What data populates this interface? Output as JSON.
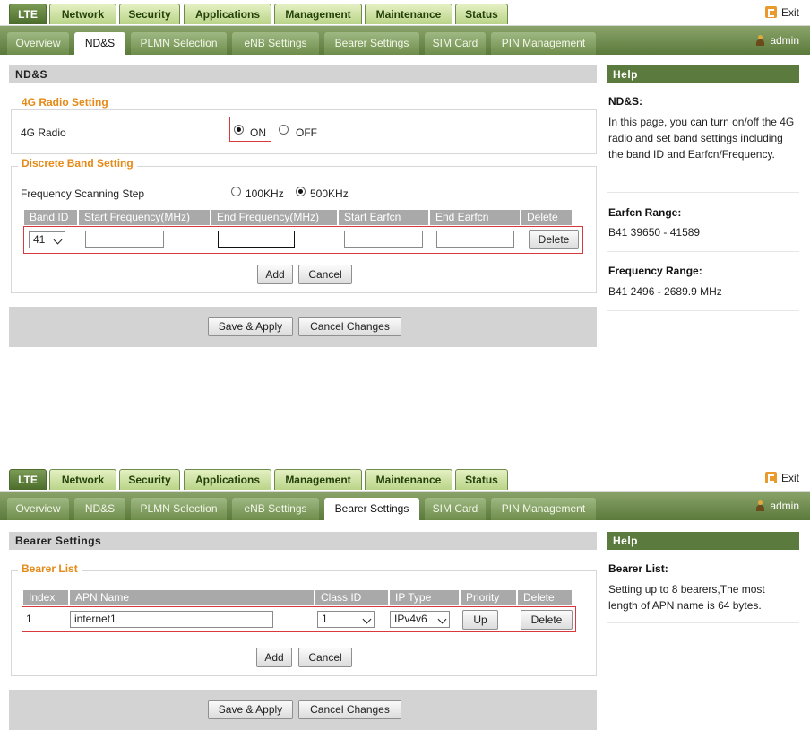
{
  "panel1": {
    "top_tabs": [
      "LTE",
      "Network",
      "Security",
      "Applications",
      "Management",
      "Maintenance",
      "Status"
    ],
    "exit_label": "Exit",
    "sub_tabs": [
      "Overview",
      "ND&S",
      "PLMN Selection",
      "eNB Settings",
      "Bearer Settings",
      "SIM Card",
      "PIN Management"
    ],
    "active_sub_tab": "ND&S",
    "user": "admin",
    "section_title": "ND&S",
    "radio_section": {
      "legend": "4G Radio Setting",
      "label": "4G Radio",
      "on_label": "ON",
      "off_label": "OFF",
      "selected": "ON"
    },
    "band_section": {
      "legend": "Discrete Band Setting",
      "scan_label": "Frequency Scanning Step",
      "scan_100": "100KHz",
      "scan_500": "500KHz",
      "scan_selected": "500KHz",
      "columns": [
        "Band ID",
        "Start Frequency(MHz)",
        "End Frequency(MHz)",
        "Start Earfcn",
        "End Earfcn",
        "Delete"
      ],
      "row": {
        "band_id": "41",
        "start_freq": "",
        "end_freq": "",
        "start_earfcn": "",
        "end_earfcn": "",
        "delete_label": "Delete"
      },
      "add_label": "Add",
      "cancel_label": "Cancel"
    },
    "save_label": "Save & Apply",
    "cancel_changes_label": "Cancel Changes",
    "help": {
      "header": "Help",
      "title1": "ND&S:",
      "text1": "In this page, you can turn on/off the 4G radio and set band settings including the band ID and Earfcn/Frequency.",
      "title2": "Earfcn Range:",
      "text2": "B41 39650 - 41589",
      "title3": "Frequency Range:",
      "text3": "B41 2496 - 2689.9 MHz"
    }
  },
  "panel2": {
    "top_tabs": [
      "LTE",
      "Network",
      "Security",
      "Applications",
      "Management",
      "Maintenance",
      "Status"
    ],
    "exit_label": "Exit",
    "sub_tabs": [
      "Overview",
      "ND&S",
      "PLMN Selection",
      "eNB Settings",
      "Bearer Settings",
      "SIM Card",
      "PIN Management"
    ],
    "active_sub_tab": "Bearer Settings",
    "user": "admin",
    "section_title": "Bearer Settings",
    "bearer_section": {
      "legend": "Bearer List",
      "columns": [
        "Index",
        "APN Name",
        "Class ID",
        "IP Type",
        "Priority",
        "Delete"
      ],
      "row": {
        "index": "1",
        "apn_name": "internet1",
        "class_id": "1",
        "ip_type": "IPv4v6",
        "up_label": "Up",
        "delete_label": "Delete"
      },
      "add_label": "Add",
      "cancel_label": "Cancel"
    },
    "save_label": "Save & Apply",
    "cancel_changes_label": "Cancel Changes",
    "help": {
      "header": "Help",
      "title1": "Bearer List:",
      "text1": "Setting up to 8 bearers,The most length of APN name is 64 bytes."
    }
  },
  "colors": {
    "tab_green": "#5b7a3e",
    "accent_orange": "#e58a17",
    "highlight_red": "#d9393d",
    "header_gray": "#d3d3d3"
  }
}
